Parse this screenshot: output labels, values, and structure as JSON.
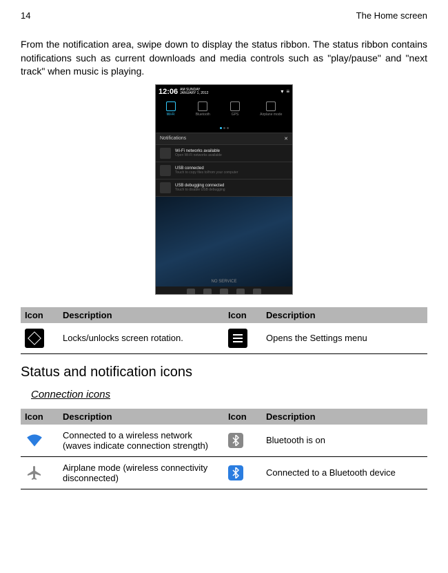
{
  "header": {
    "page_number": "14",
    "section": "The Home screen"
  },
  "body_text": "From the  notification area, swipe down to display the status ribbon. The status ribbon contains notifications such as current downloads and media controls such as \"play/pause\" and \"next track\" when music is playing.",
  "screenshot": {
    "clock": "12:06",
    "ampm": "AM",
    "date_line1": "SUNDAY",
    "date_line2": "JANUARY 1, 2012",
    "toggles": {
      "wifi": "Wi-Fi",
      "bluetooth": "Bluetooth",
      "gps": "GPS",
      "airplane": "Airplane mode"
    },
    "notif_header": "Notifications",
    "notifs": [
      {
        "title": "Wi-Fi networks available",
        "sub": "Open Wi-Fi networks available"
      },
      {
        "title": "USB connected",
        "sub": "Touch to copy files to/from your computer"
      },
      {
        "title": "USB debugging connected",
        "sub": "Touch to disable USB debugging"
      }
    ],
    "no_service": "NO SERVICE"
  },
  "table1": {
    "headers": {
      "icon": "Icon",
      "description": "Description"
    },
    "rows": [
      {
        "desc1": "Locks/unlocks screen rotation.",
        "desc2": "Opens the Settings menu"
      }
    ]
  },
  "section_title": "Status and notification icons",
  "subsection_title": "Connection icons",
  "table2": {
    "headers": {
      "icon": "Icon",
      "description": "Description"
    },
    "rows": [
      {
        "desc1": "Connected to a wireless network (waves indicate connection strength)",
        "desc2": "Bluetooth is on"
      },
      {
        "desc1": "Airplane mode (wireless connectivity disconnected)",
        "desc2": "Connected to a Bluetooth device"
      }
    ]
  }
}
